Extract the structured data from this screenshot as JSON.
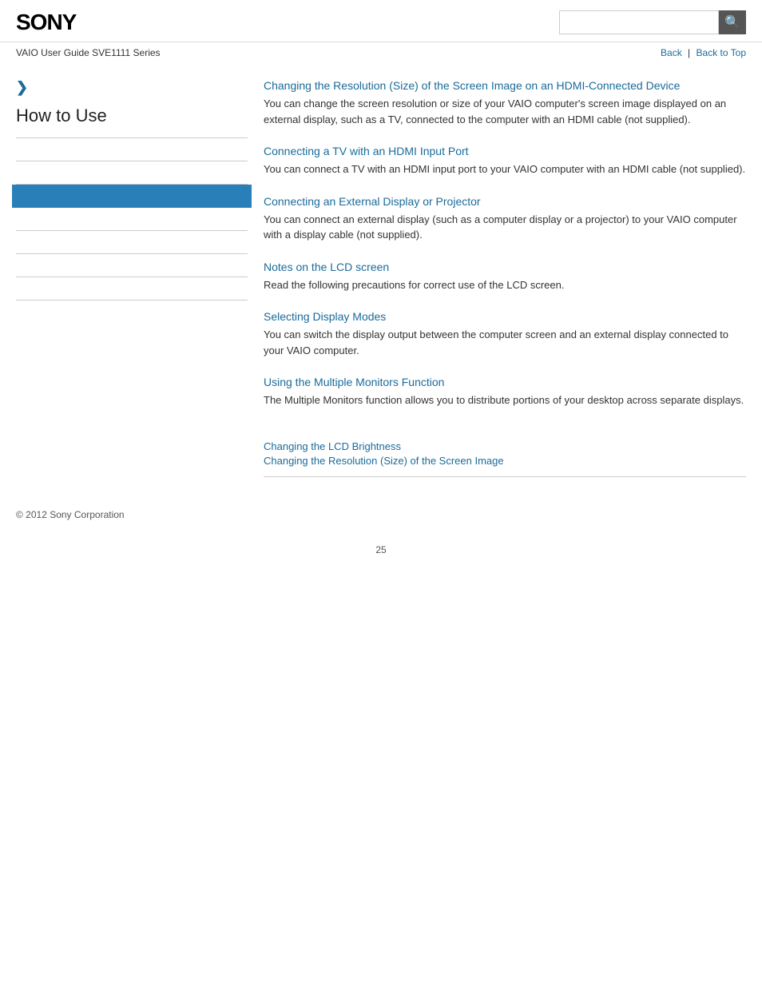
{
  "header": {
    "logo": "SONY",
    "search_placeholder": "",
    "search_icon": "🔍"
  },
  "subheader": {
    "guide_title": "VAIO User Guide SVE1111 Series",
    "nav": {
      "back_label": "Back",
      "separator": "|",
      "back_to_top_label": "Back to Top"
    }
  },
  "sidebar": {
    "arrow": "❯",
    "title": "How to Use",
    "items": [
      {
        "label": "",
        "active": false
      },
      {
        "label": "",
        "active": false
      },
      {
        "label": "",
        "active": true
      },
      {
        "label": "",
        "active": false
      },
      {
        "label": "",
        "active": false
      },
      {
        "label": "",
        "active": false
      },
      {
        "label": "",
        "active": false
      }
    ]
  },
  "content": {
    "sections": [
      {
        "link": "Changing the Resolution (Size) of the Screen Image on an HDMI-Connected Device",
        "desc": "You can change the screen resolution or size of your VAIO computer's screen image displayed on an external display, such as a TV, connected to the computer with an HDMI cable (not supplied)."
      },
      {
        "link": "Connecting a TV with an HDMI Input Port",
        "desc": "You can connect a TV with an HDMI input port to your VAIO computer with an HDMI cable (not supplied)."
      },
      {
        "link": "Connecting an External Display or Projector",
        "desc": "You can connect an external display (such as a computer display or a projector) to your VAIO computer with a display cable (not supplied)."
      },
      {
        "link": "Notes on the LCD screen",
        "desc": "Read the following precautions for correct use of the LCD screen."
      },
      {
        "link": "Selecting Display Modes",
        "desc": "You can switch the display output between the computer screen and an external display connected to your VAIO computer."
      },
      {
        "link": "Using the Multiple Monitors Function",
        "desc": "The Multiple Monitors function allows you to distribute portions of your desktop across separate displays."
      }
    ],
    "bottom_links": [
      "Changing the LCD Brightness",
      "Changing the Resolution (Size) of the Screen Image"
    ]
  },
  "footer": {
    "copyright": "© 2012 Sony Corporation"
  },
  "page_number": "25"
}
